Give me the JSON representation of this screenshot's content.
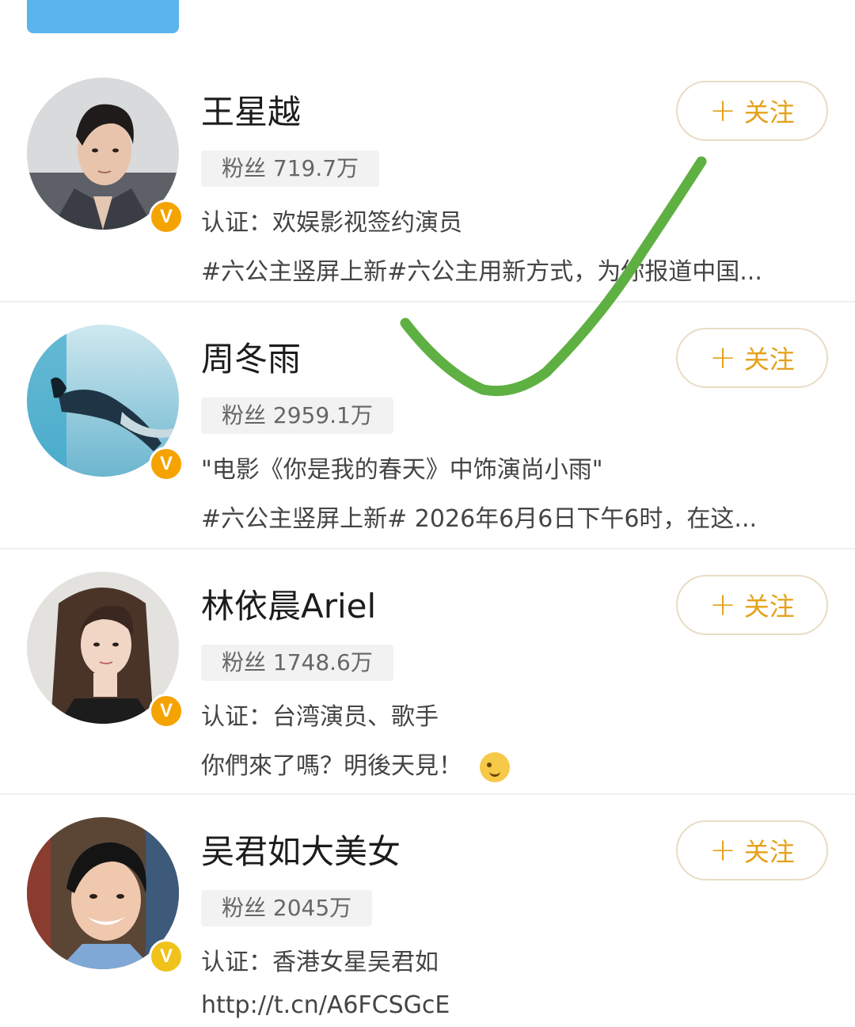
{
  "cards": [
    {
      "name": "王星越",
      "fans": "粉丝 719.7万",
      "cert": "认证：欢娱影视签约演员",
      "desc": "#六公主竖屏上新#六公主用新方式，为你报道中国...",
      "follow_label": "关注",
      "verified_color": "#f5a300"
    },
    {
      "name": "周冬雨",
      "fans": "粉丝 2959.1万",
      "cert": "\"电影《你是我的春天》中饰演尚小雨\"",
      "desc": "#六公主竖屏上新# 2026年6月6日下午6时，在这...",
      "follow_label": "关注",
      "verified_color": "#f5a300"
    },
    {
      "name": "林依晨Ariel",
      "fans": "粉丝 1748.6万",
      "cert": "认证：台湾演员、歌手",
      "desc": "你們來了嗎？明後天見！",
      "desc_emoji": "wink-emoji",
      "follow_label": "关注",
      "verified_color": "#f5a300"
    },
    {
      "name": "吴君如大美女",
      "fans": "粉丝 2045万",
      "cert": "认证：香港女星吴君如",
      "desc": "http://t.cn/A6FCSGcE",
      "follow_label": "关注",
      "verified_color": "#f0c21a"
    }
  ],
  "verified_badge": "V",
  "colors": {
    "follow_accent": "#e5a11a",
    "top_tab": "#5bb4ec",
    "check_mark": "#5fb043"
  }
}
